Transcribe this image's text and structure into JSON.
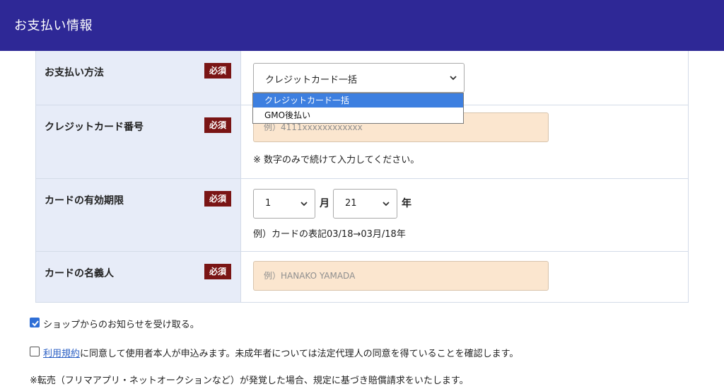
{
  "header": {
    "title": "お支払い情報"
  },
  "form": {
    "required_badge": "必須",
    "payment_method": {
      "label": "お支払い方法",
      "selected": "クレジットカード一括",
      "options": [
        "クレジットカード一括",
        "GMO後払い"
      ]
    },
    "card_number": {
      "label": "クレジットカード番号",
      "placeholder": "例）4111xxxxxxxxxxxx",
      "note": "※ 数字のみで続けて入力してください。"
    },
    "expiry": {
      "label": "カードの有効期限",
      "month_value": "1",
      "month_unit": "月",
      "year_value": "21",
      "year_unit": "年",
      "note": "例）カードの表記03/18→03月/18年"
    },
    "card_holder": {
      "label": "カードの名義人",
      "placeholder": "例）HANAKO YAMADA"
    }
  },
  "consents": {
    "newsletter": {
      "label": "ショップからのお知らせを受け取る。",
      "checked": true
    },
    "terms": {
      "link_text": "利用規約",
      "label_rest": "に同意して使用者本人が申込みます。未成年者については法定代理人の同意を得ていることを確認します。",
      "checked": false
    }
  },
  "footnote": "※転売（フリマアプリ・ネットオークションなど）が発覚した場合、規定に基づき賠償請求をいたします。",
  "colors": {
    "header_bg": "#2e2896",
    "badge_bg": "#7a1515",
    "label_cell_bg": "#e7ecf8",
    "input_bg": "#fbe6cf",
    "dropdown_highlight": "#3d7fe0",
    "link": "#2a5fc4"
  }
}
